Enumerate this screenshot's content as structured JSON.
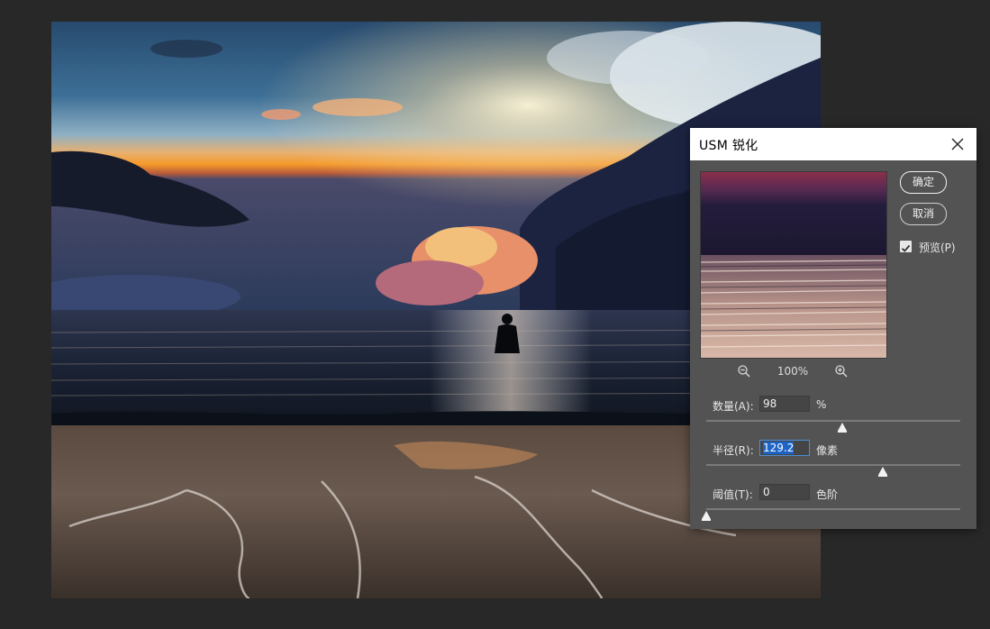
{
  "dialog": {
    "title": "USM 锐化",
    "ok_label": "确定",
    "cancel_label": "取消",
    "preview_label": "预览(P)",
    "preview_checked": true,
    "zoom_level": "100%",
    "params": [
      {
        "label": "数量(A):",
        "value": "98",
        "unit": "%",
        "level": 0.535
      },
      {
        "label": "半径(R):",
        "value": "129.2",
        "unit": "像素",
        "level": 0.695
      },
      {
        "label": "阈值(T):",
        "value": "0",
        "unit": "色阶",
        "level": 0.0
      }
    ]
  },
  "icons": {
    "close": "close-icon",
    "zoom_out": "zoom-out-icon",
    "zoom_in": "zoom-in-icon",
    "checkbox": "checkmark-icon"
  },
  "colors": {
    "dialog_bg": "#535353",
    "accent_selection": "#1e63c6",
    "app_bg": "#282828"
  }
}
